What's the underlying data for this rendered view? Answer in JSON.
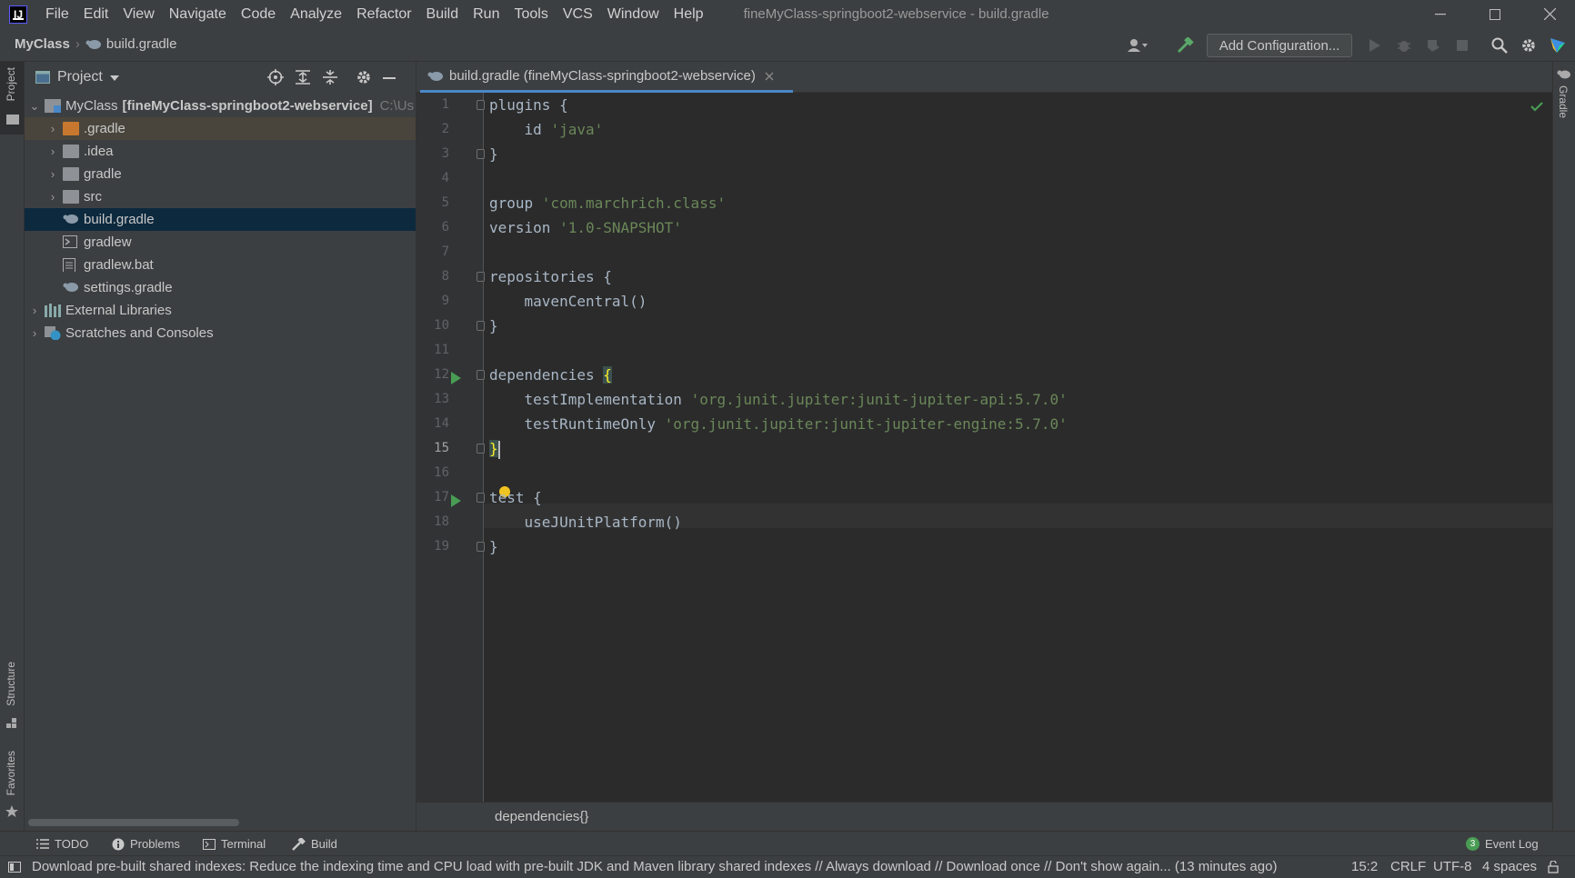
{
  "menubar": {
    "logo": "IJ",
    "items": [
      "File",
      "Edit",
      "View",
      "Navigate",
      "Code",
      "Analyze",
      "Refactor",
      "Build",
      "Run",
      "Tools",
      "VCS",
      "Window",
      "Help"
    ],
    "window_title": "fineMyClass-springboot2-webservice - build.gradle"
  },
  "navbar": {
    "crumb_root": "MyClass",
    "crumb_file": "build.gradle",
    "add_config": "Add Configuration..."
  },
  "left_strip": {
    "project_tab": "Project",
    "structure_tab": "Structure",
    "favorites_tab": "Favorites"
  },
  "right_strip": {
    "gradle_tab": "Gradle"
  },
  "project_panel": {
    "title": "Project",
    "tree": [
      {
        "label": "MyClass",
        "bold": "[fineMyClass-springboot2-webservice]",
        "path": "C:\\Us"
      },
      {
        "label": ".gradle"
      },
      {
        "label": ".idea"
      },
      {
        "label": "gradle"
      },
      {
        "label": "src"
      },
      {
        "label": "build.gradle"
      },
      {
        "label": "gradlew"
      },
      {
        "label": "gradlew.bat"
      },
      {
        "label": "settings.gradle"
      },
      {
        "label": "External Libraries"
      },
      {
        "label": "Scratches and Consoles"
      }
    ]
  },
  "editor": {
    "tab_label": "build.gradle (fineMyClass-springboot2-webservice)",
    "lines": [
      {
        "num": "1",
        "code": "plugins {",
        "str": ""
      },
      {
        "num": "2",
        "code": "    id ",
        "str": "'java'"
      },
      {
        "num": "3",
        "code": "}",
        "str": ""
      },
      {
        "num": "4",
        "code": "",
        "str": ""
      },
      {
        "num": "5",
        "code": "group ",
        "str": "'com.marchrich.class'"
      },
      {
        "num": "6",
        "code": "version ",
        "str": "'1.0-SNAPSHOT'"
      },
      {
        "num": "7",
        "code": "",
        "str": ""
      },
      {
        "num": "8",
        "code": "repositories {",
        "str": ""
      },
      {
        "num": "9",
        "code": "    mavenCentral()",
        "str": ""
      },
      {
        "num": "10",
        "code": "}",
        "str": ""
      },
      {
        "num": "11",
        "code": "",
        "str": ""
      },
      {
        "num": "12",
        "code": "dependencies ",
        "str": ""
      },
      {
        "num": "13",
        "code": "    testImplementation ",
        "str": "'org.junit.jupiter:junit-jupiter-api:5.7.0'"
      },
      {
        "num": "14",
        "code": "    testRuntimeOnly ",
        "str": "'org.junit.jupiter:junit-jupiter-engine:5.7.0'"
      },
      {
        "num": "15",
        "code": "",
        "str": ""
      },
      {
        "num": "16",
        "code": "",
        "str": ""
      },
      {
        "num": "17",
        "code": "test {",
        "str": ""
      },
      {
        "num": "18",
        "code": "    useJUnitPlatform()",
        "str": ""
      },
      {
        "num": "19",
        "code": "}",
        "str": ""
      }
    ],
    "brace_open": "{",
    "brace_close": "}",
    "code_crumb": "dependencies{}"
  },
  "toolwindows": {
    "todo": "TODO",
    "problems": "Problems",
    "terminal": "Terminal",
    "build": "Build",
    "event_log_count": "3",
    "event_log": "Event Log"
  },
  "status": {
    "message": "Download pre-built shared indexes: Reduce the indexing time and CPU load with pre-built JDK and Maven library shared indexes // Always download // Download once // Don't show again... (13 minutes ago)",
    "position": "15:2",
    "line_sep": "CRLF",
    "encoding": "UTF-8",
    "indent": "4 spaces"
  },
  "colors": {
    "accent": "#4a88c7",
    "selection": "#0d293e",
    "string": "#6a8759",
    "run_green": "#499c54"
  }
}
